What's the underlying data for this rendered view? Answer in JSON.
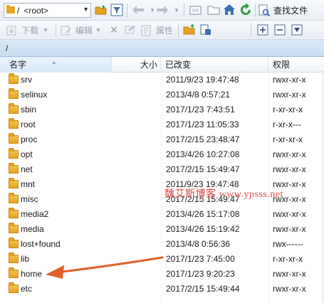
{
  "toolbar1": {
    "path_slash": "/",
    "path_value": "<root>",
    "find_file_label": "查找文件",
    "icons": [
      "folder-icon",
      "chevron-down-icon",
      "open-folder-icon",
      "filter-icon",
      "back-arrow-icon",
      "forward-arrow-icon",
      "refresh-icon",
      "home-icon",
      "parent-folder-icon",
      "find-icon"
    ]
  },
  "toolbar2": {
    "download_label": "下载",
    "edit_label": "编辑",
    "properties_label": "属性"
  },
  "pathbar": {
    "path": "/"
  },
  "columns": {
    "name": "名字",
    "size": "大小",
    "modified": "已改变",
    "permissions": "权限"
  },
  "files": [
    {
      "name": "srv",
      "modified": "2011/9/23 19:47:48",
      "permissions": "rwxr-xr-x"
    },
    {
      "name": "selinux",
      "modified": "2013/4/8 0:57:21",
      "permissions": "rwxr-xr-x"
    },
    {
      "name": "sbin",
      "modified": "2017/1/23 7:43:51",
      "permissions": "r-xr-xr-x"
    },
    {
      "name": "root",
      "modified": "2017/1/23 11:05:33",
      "permissions": "r-xr-x---"
    },
    {
      "name": "proc",
      "modified": "2017/2/15 23:48:47",
      "permissions": "r-xr-xr-x"
    },
    {
      "name": "opt",
      "modified": "2013/4/26 10:27:08",
      "permissions": "rwxr-xr-x"
    },
    {
      "name": "net",
      "modified": "2017/2/15 15:49:47",
      "permissions": "rwxr-xr-x"
    },
    {
      "name": "mnt",
      "modified": "2011/9/23 19:47:48",
      "permissions": "rwxr-xr-x"
    },
    {
      "name": "misc",
      "modified": "2017/2/15 15:49:47",
      "permissions": "rwxr-xr-x"
    },
    {
      "name": "media2",
      "modified": "2013/4/26 15:17:08",
      "permissions": "rwxr-xr-x"
    },
    {
      "name": "media",
      "modified": "2013/4/26 15:19:42",
      "permissions": "rwxr-xr-x"
    },
    {
      "name": "lost+found",
      "modified": "2013/4/8 0:56:36",
      "permissions": "rwx------"
    },
    {
      "name": "lib",
      "modified": "2017/1/23 7:45:00",
      "permissions": "r-xr-xr-x"
    },
    {
      "name": "home",
      "modified": "2017/1/23 9:20:23",
      "permissions": "rwxr-xr-x"
    },
    {
      "name": "etc",
      "modified": "2017/2/15 15:49:44",
      "permissions": "rwxr-xr-x"
    }
  ],
  "watermark": "魏艾斯博客 www.ypsss.net",
  "annotation": {
    "arrow_color": "#e0602a",
    "points_to": "home"
  },
  "colors": {
    "folder": "#e7a21f",
    "pathbar": "#c6dcf1",
    "watermark": "#e04848"
  }
}
